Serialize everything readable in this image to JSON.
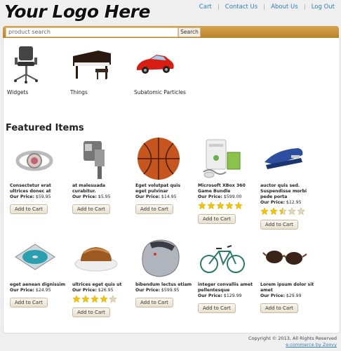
{
  "header": {
    "logo": "Your Logo Here",
    "nav": [
      "Cart",
      "Contact Us",
      "About Us",
      "Log Out"
    ]
  },
  "search": {
    "placeholder": "product search",
    "button": "Search"
  },
  "categories": [
    {
      "label": "Widgets",
      "icon": "office-chair-icon"
    },
    {
      "label": "Things",
      "icon": "piano-icon"
    },
    {
      "label": "Subatomic Particles",
      "icon": "sports-car-icon"
    }
  ],
  "featured": {
    "title": "Featured Items",
    "price_label": "Our Price:",
    "cart_label": "Add to Cart",
    "items": [
      {
        "name": "Consectetur erat ultrices donec at",
        "price": "$59.95",
        "stars": null,
        "icon": "watch-icon"
      },
      {
        "name": "at malesuada curabitur.",
        "price": "$5.95",
        "stars": null,
        "icon": "sprayer-icon"
      },
      {
        "name": "Eget volutpat quis eget pulvinar",
        "price": "$14.95",
        "stars": null,
        "icon": "basketball-icon"
      },
      {
        "name": "Microsoft XBox 360 Game Bundle",
        "price": "$599.00",
        "stars": 5,
        "icon": "game-console-icon"
      },
      {
        "name": "auctor quis sed. Suspendisse morbi pede porta",
        "price": "$12.95",
        "stars": 2.5,
        "icon": "stapler-icon"
      },
      {
        "name": "eget aenean dignissim",
        "price": "$24.95",
        "stars": null,
        "icon": "cd-case-icon"
      },
      {
        "name": "ultrices eget quis ut",
        "price": "$26.95",
        "stars": 4,
        "icon": "cake-icon"
      },
      {
        "name": "bibendum lectus etiam",
        "price": "$599.95",
        "stars": null,
        "icon": "mouse-icon"
      },
      {
        "name": "integer convallis amet pellentesque",
        "price": "$129.99",
        "stars": null,
        "icon": "bicycle-icon"
      },
      {
        "name": "Lorem ipsum dolor sit amet",
        "price": "$29.99",
        "stars": null,
        "icon": "sunglasses-icon"
      }
    ]
  },
  "footer": {
    "copyright": "Copyright © 2013, All Rights Reserved",
    "credit": "e-commerce by Zoovy"
  },
  "colors": {
    "link": "#2e7fb8",
    "bar": "#c8913a",
    "star": "#f5c400"
  }
}
